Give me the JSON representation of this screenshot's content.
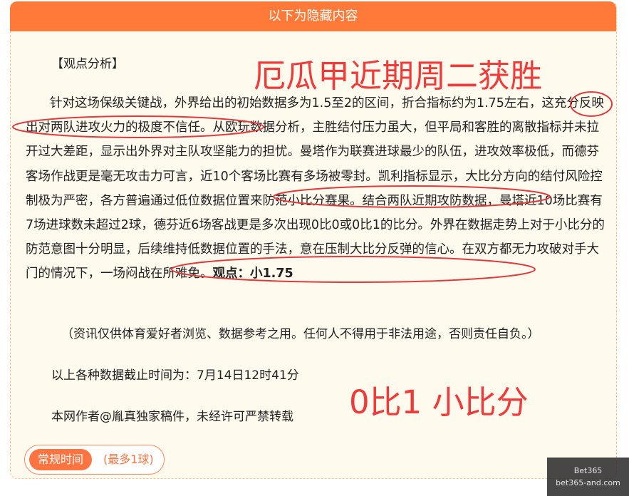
{
  "header": {
    "title": "以下为隐藏内容"
  },
  "overlay": {
    "title": "厄瓜甲近期周二获胜",
    "score": "0比1 小比分"
  },
  "article": {
    "section_heading": "【观点分析】",
    "p1": "针对这场保级关键战，外界给出的初始数据多为1.5至2的区间，折合指标约为1.75左右，",
    "p2": "这充分反映出对两队进攻火力的极度不信任。",
    "p3": "从欧玩数据分析，主胜结付压力虽大，但平局和客胜的离散指标并未拉开过大差距，显示出外界对主队攻坚能力的担忧。曼塔作为联赛进球最少的队伍，进攻效率极低，而德芬客场作战更是毫无攻击力可言，近10个客场比赛有多场被零封。凯利指标显示，大比分方向的结付风险控制极为严密，",
    "p4": "各方普遍通过低位数据位置来防范小比分赛果。",
    "p5": "结合两队近期攻防数据，曼塔近10场比赛有7场进球数未超过2球，德芬近6场客战更是多次出现0比0或0比1的比分。外界在数据走势上对于小比分的防范意图十分明显，后续维持低数据位置的手法，意在压制大比分反弹的信心。",
    "p6": "在双方都无力攻破对手大门的情况下，一场闷战在所难免。",
    "verdict": "观点：小1.75",
    "notice": "（资讯仅供体育爱好者浏览、数据参考之用。任何人不得用于非法用途，否则责任自负。）",
    "cutoff": "以上各种数据截止时间为：7月14日12时41分",
    "author": "本网作者@胤真独家稿件，未经许可严禁转载"
  },
  "tag": {
    "pill": "常规时间",
    "text": "(最多1球)"
  },
  "watermark": {
    "line1": "Bet365",
    "line2": "bet365-and.com"
  },
  "colors": {
    "accent": "#ff7a38",
    "annotation": "#f03b3b",
    "panel_bg": "#fff9ee"
  }
}
